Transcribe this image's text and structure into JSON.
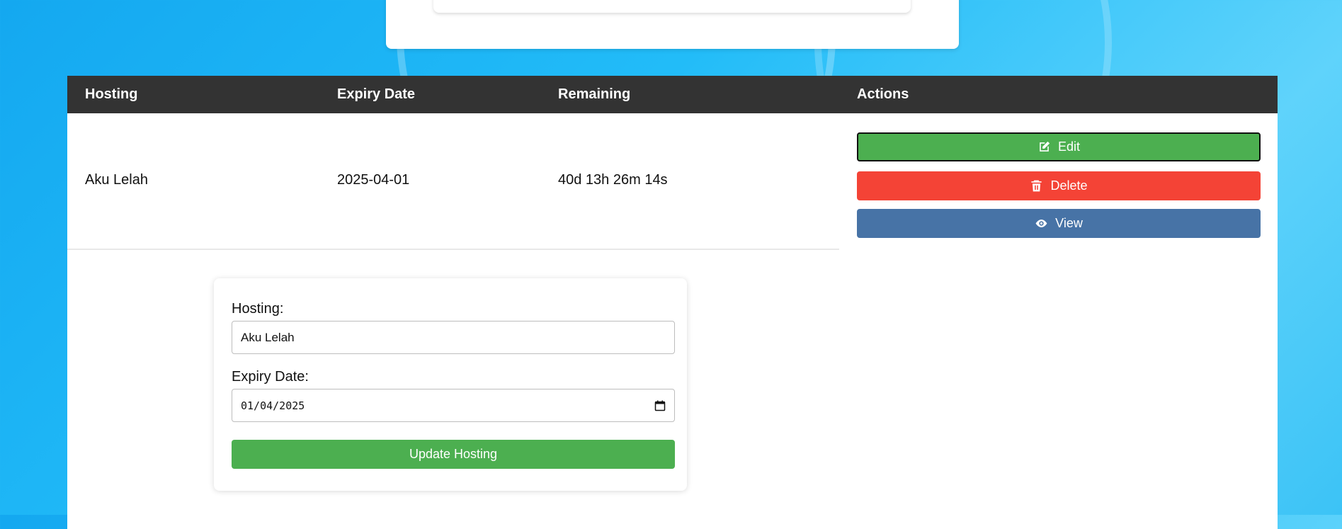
{
  "table": {
    "headers": {
      "hosting": "Hosting",
      "expiry_date": "Expiry Date",
      "remaining": "Remaining",
      "actions": "Actions"
    },
    "rows": [
      {
        "hosting": "Aku Lelah",
        "expiry_date": "2025-04-01",
        "remaining": "40d 13h 26m 14s",
        "actions": {
          "edit": "Edit",
          "delete": "Delete",
          "view": "View"
        }
      }
    ]
  },
  "edit_form": {
    "hosting_label": "Hosting:",
    "hosting_value": "Aku Lelah",
    "expiry_label": "Expiry Date:",
    "expiry_value": "01/04/2025",
    "submit_label": "Update Hosting"
  },
  "colors": {
    "header_bg": "#333333",
    "edit": "#4caf50",
    "delete": "#f44336",
    "view": "#4773a6",
    "update": "#4caf50"
  },
  "icons": {
    "edit": "edit-icon",
    "delete": "trash-icon",
    "view": "eye-icon",
    "calendar": "calendar-icon"
  }
}
